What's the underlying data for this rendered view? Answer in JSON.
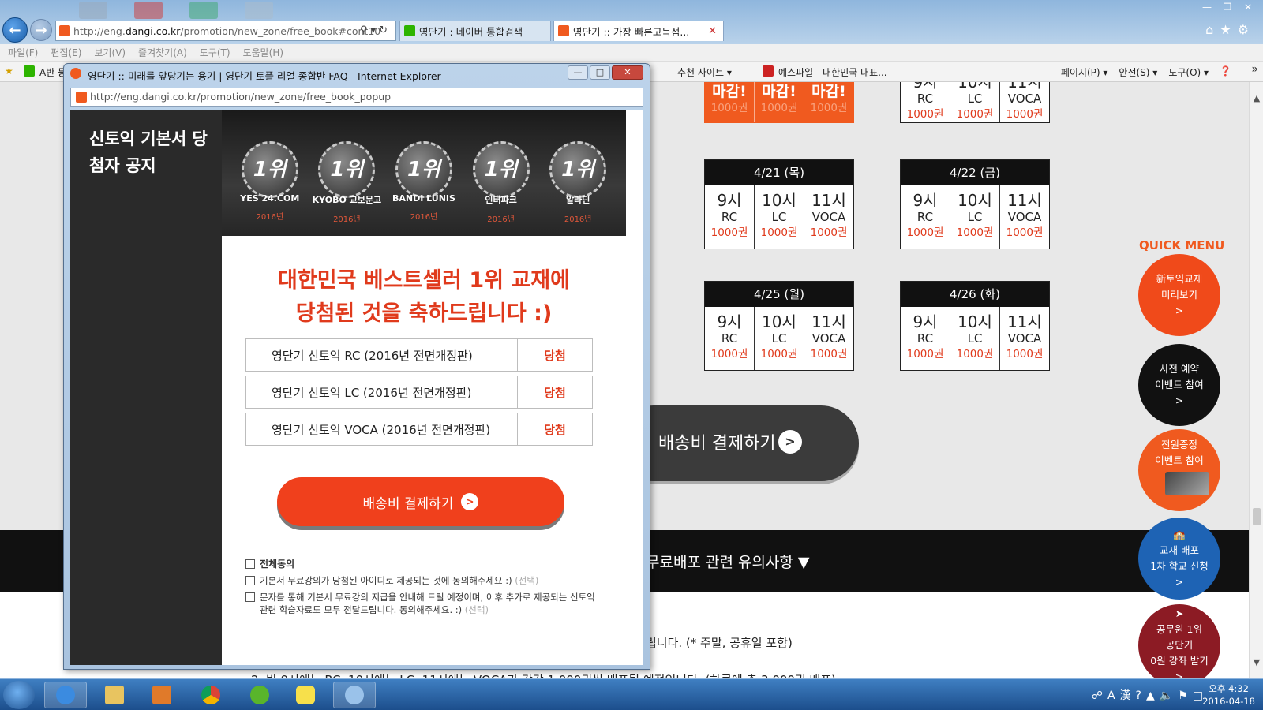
{
  "browser": {
    "address": {
      "prefix": "http://eng.",
      "domain": "dangi.co.kr",
      "path": "/promotion/new_zone/free_book#cont10"
    },
    "tabs": [
      {
        "label": "영단기 : 네이버 통합검색"
      },
      {
        "label": "영단기 :: 가장 빠른고득점..."
      }
    ],
    "menu": [
      "파일(F)",
      "편집(E)",
      "보기(V)",
      "즐겨찾기(A)",
      "도구(T)",
      "도움말(H)"
    ],
    "favorites": {
      "left": "A반 등",
      "item1": "추천 사이트 ▾",
      "item2": "예스파일 - 대한민국 대표...",
      "right": [
        "페이지(P) ▾",
        "안전(S) ▾",
        "도구(O) ▾"
      ]
    }
  },
  "background_page": {
    "top_left_cells": [
      {
        "time": "마감!",
        "qty": "1000권"
      },
      {
        "time": "마감!",
        "qty": "1000권"
      },
      {
        "time": "마감!",
        "qty": "1000권"
      }
    ],
    "top_right_cells": [
      {
        "time": "9시",
        "subject": "RC",
        "qty": "1000권"
      },
      {
        "time": "10시",
        "subject": "LC",
        "qty": "1000권"
      },
      {
        "time": "11시",
        "subject": "VOCA",
        "qty": "1000권"
      }
    ],
    "schedules": [
      {
        "date": "4/21 (목)",
        "cells": [
          {
            "time": "9시",
            "subject": "RC",
            "qty": "1000권"
          },
          {
            "time": "10시",
            "subject": "LC",
            "qty": "1000권"
          },
          {
            "time": "11시",
            "subject": "VOCA",
            "qty": "1000권"
          }
        ]
      },
      {
        "date": "4/22 (금)",
        "cells": [
          {
            "time": "9시",
            "subject": "RC",
            "qty": "1000권"
          },
          {
            "time": "10시",
            "subject": "LC",
            "qty": "1000권"
          },
          {
            "time": "11시",
            "subject": "VOCA",
            "qty": "1000권"
          }
        ]
      },
      {
        "date": "4/25 (월)",
        "cells": [
          {
            "time": "9시",
            "subject": "RC",
            "qty": "1000권"
          },
          {
            "time": "10시",
            "subject": "LC",
            "qty": "1000권"
          },
          {
            "time": "11시",
            "subject": "VOCA",
            "qty": "1000권"
          }
        ]
      },
      {
        "date": "4/26 (화)",
        "cells": [
          {
            "time": "9시",
            "subject": "RC",
            "qty": "1000권"
          },
          {
            "time": "10시",
            "subject": "LC",
            "qty": "1000권"
          },
          {
            "time": "11시",
            "subject": "VOCA",
            "qty": "1000권"
          }
        ]
      }
    ],
    "pay_button": "배송비 결제하기",
    "notice_bar": "무료배포 관련 유의사항 ▼",
    "notice_line1": "립니다. (* 주말, 공휴일 포함)",
    "notice_line2": "2. 반 9시에는 RC, 10시에는 LC, 11시에는 VOCA가 각각 1,000권씩 배포될 예정입니다. (하루에 총 3,000권 배포)",
    "quick_menu": {
      "title": "QUICK MENU",
      "items": [
        {
          "lines": [
            "新토익교재",
            "미리보기",
            ">"
          ]
        },
        {
          "lines": [
            "사전 예약",
            "이벤트 참여",
            ">"
          ]
        },
        {
          "lines": [
            "전원증정",
            "이벤트 참여"
          ]
        },
        {
          "lines": [
            "교재 배포",
            "1차 학교 신청",
            ">"
          ]
        },
        {
          "lines": [
            "공무원 1위",
            "공단기",
            "0원 강좌 받기",
            ">"
          ]
        }
      ]
    }
  },
  "popup": {
    "title": "영단기 :: 미래를 앞당기는 용기 | 영단기 토플 리얼 종합반 FAQ - Internet Explorer",
    "address": "http://eng.dangi.co.kr/promotion/new_zone/free_book_popup",
    "left_title": "신토익 기본서 당첨자 공지",
    "awards": [
      {
        "rank": "1위",
        "brand": "YES 24.COM",
        "year": "2016년"
      },
      {
        "rank": "1위",
        "brand": "KYOBO 교보문고",
        "year": "2016년"
      },
      {
        "rank": "1위",
        "brand": "BANDI LUNIS",
        "year": "2016년"
      },
      {
        "rank": "1위",
        "brand": "인터파크",
        "year": "2016년"
      },
      {
        "rank": "1위",
        "brand": "알라딘",
        "year": "2016년"
      }
    ],
    "congrats_line1": "대한민국 베스트셀러 1위 교재에",
    "congrats_line2": "당첨된 것을 축하드립니다 :)",
    "prizes": [
      {
        "name": "영단기 신토익 RC (2016년 전면개정판)",
        "status": "당첨"
      },
      {
        "name": "영단기 신토익 LC (2016년 전면개정판)",
        "status": "당첨"
      },
      {
        "name": "영단기 신토익 VOCA (2016년 전면개정판)",
        "status": "당첨"
      }
    ],
    "pay_button": "배송비 결제하기",
    "agree_all": "전체동의",
    "agree1": "기본서 무료강의가 당첨된 아이디로 제공되는 것에 동의해주세요 :)",
    "agree1_opt": "(선택)",
    "agree2": "문자를 통해 기본서 무료강의 지급을 안내해 드릴 예정이며, 이후 추가로 제공되는 신토익 관련 학습자료도 모두 전달드립니다. 동의해주세요. :)",
    "agree2_opt": "(선택)"
  },
  "taskbar": {
    "clock_time": "오후 4:32",
    "clock_date": "2016-04-18"
  },
  "colors": {
    "accent": "#f0401c",
    "brand_orange": "#f05a1f",
    "dark": "#111111"
  }
}
